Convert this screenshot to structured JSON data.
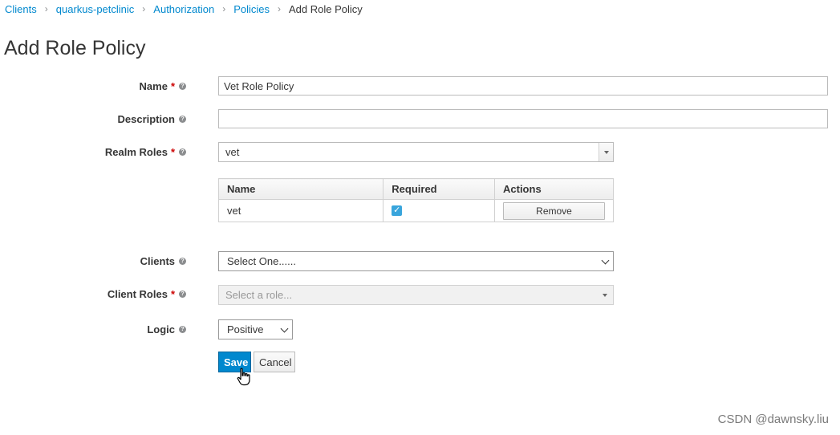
{
  "breadcrumb": {
    "items": [
      "Clients",
      "quarkus-petclinic",
      "Authorization",
      "Policies"
    ],
    "current": "Add Role Policy",
    "separator": "›"
  },
  "page": {
    "title": "Add Role Policy"
  },
  "form": {
    "name": {
      "label": "Name",
      "required": "*",
      "value": "Vet Role Policy"
    },
    "description": {
      "label": "Description",
      "value": ""
    },
    "realm_roles": {
      "label": "Realm Roles",
      "required": "*",
      "value": "vet",
      "table": {
        "headers": [
          "Name",
          "Required",
          "Actions"
        ],
        "rows": [
          {
            "name": "vet",
            "required": true,
            "action": "Remove"
          }
        ]
      }
    },
    "clients": {
      "label": "Clients",
      "value": "Select One......"
    },
    "client_roles": {
      "label": "Client Roles",
      "required": "*",
      "placeholder": "Select a role..."
    },
    "logic": {
      "label": "Logic",
      "value": "Positive"
    }
  },
  "actions": {
    "save": "Save",
    "cancel": "Cancel"
  },
  "watermark": "CSDN @dawnsky.liu",
  "icons": {
    "help": "help-circle-icon",
    "check": "checkmark-icon",
    "cursor": "hand-pointer-icon"
  },
  "colors": {
    "link": "#0088ce",
    "primary": "#0088ce",
    "checkbox": "#39a5dc",
    "required": "#cc0000"
  }
}
